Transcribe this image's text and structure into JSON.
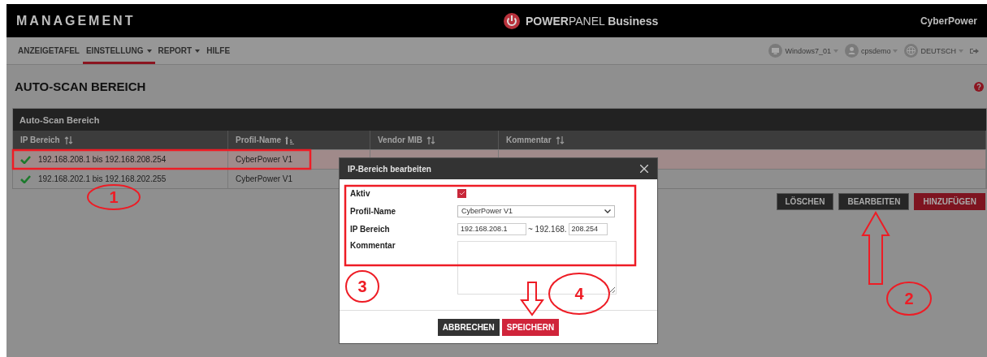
{
  "header": {
    "title": "MANAGEMENT",
    "product_bold": "POWER",
    "product_light": "PANEL",
    "product_suffix": "Business",
    "brand": "CyberPower"
  },
  "nav": [
    {
      "label": "ANZEIGETAFEL",
      "selected": false,
      "dropdown": false
    },
    {
      "label": "EINSTELLUNG",
      "selected": true,
      "dropdown": true
    },
    {
      "label": "REPORT",
      "selected": false,
      "dropdown": true
    },
    {
      "label": "HILFE",
      "selected": false,
      "dropdown": false
    }
  ],
  "user_menu": [
    {
      "kind": "monitor",
      "label": "Windows7_01"
    },
    {
      "kind": "user",
      "label": "cpsdemo"
    },
    {
      "kind": "globe",
      "label": "DEUTSCH"
    }
  ],
  "page_title": "AUTO-SCAN BEREICH",
  "panel": {
    "title": "Auto-Scan Bereich",
    "columns": [
      {
        "label": "IP Bereich",
        "sorted": false
      },
      {
        "label": "Profil-Name",
        "sorted": true
      },
      {
        "label": "Vendor MIB",
        "sorted": false
      },
      {
        "label": "Kommentar",
        "sorted": false
      }
    ],
    "rows": [
      {
        "active": true,
        "ip_range": "192.168.208.1 bis 192.168.208.254",
        "profile": "CyberPower V1",
        "selected": true
      },
      {
        "active": true,
        "ip_range": "192.168.202.1 bis 192.168.202.255",
        "profile": "CyberPower V1",
        "selected": false
      }
    ]
  },
  "actions": [
    {
      "label": "LÖSCHEN",
      "kind": "dark"
    },
    {
      "label": "BEARBEITEN",
      "kind": "dark"
    },
    {
      "label": "HINZUFÜGEN",
      "kind": "primary"
    }
  ],
  "dialog": {
    "title": "IP-Bereich bearbeiten",
    "active_label": "Aktiv",
    "active": true,
    "profile_label": "Profil-Name",
    "profile_value": "CyberPower V1",
    "range_label": "IP Bereich",
    "range_from": "192.168.208.1",
    "range_sep": "~ 192.168.",
    "range_to": "208.254",
    "comment_label": "Kommentar",
    "buttons": [
      {
        "label": "ABBRECHEN",
        "kind": "dark"
      },
      {
        "label": "SPEICHERN",
        "kind": "primary"
      }
    ]
  },
  "annotations": [
    {
      "label": "1"
    },
    {
      "label": "2"
    },
    {
      "label": "3"
    },
    {
      "label": "4"
    }
  ]
}
